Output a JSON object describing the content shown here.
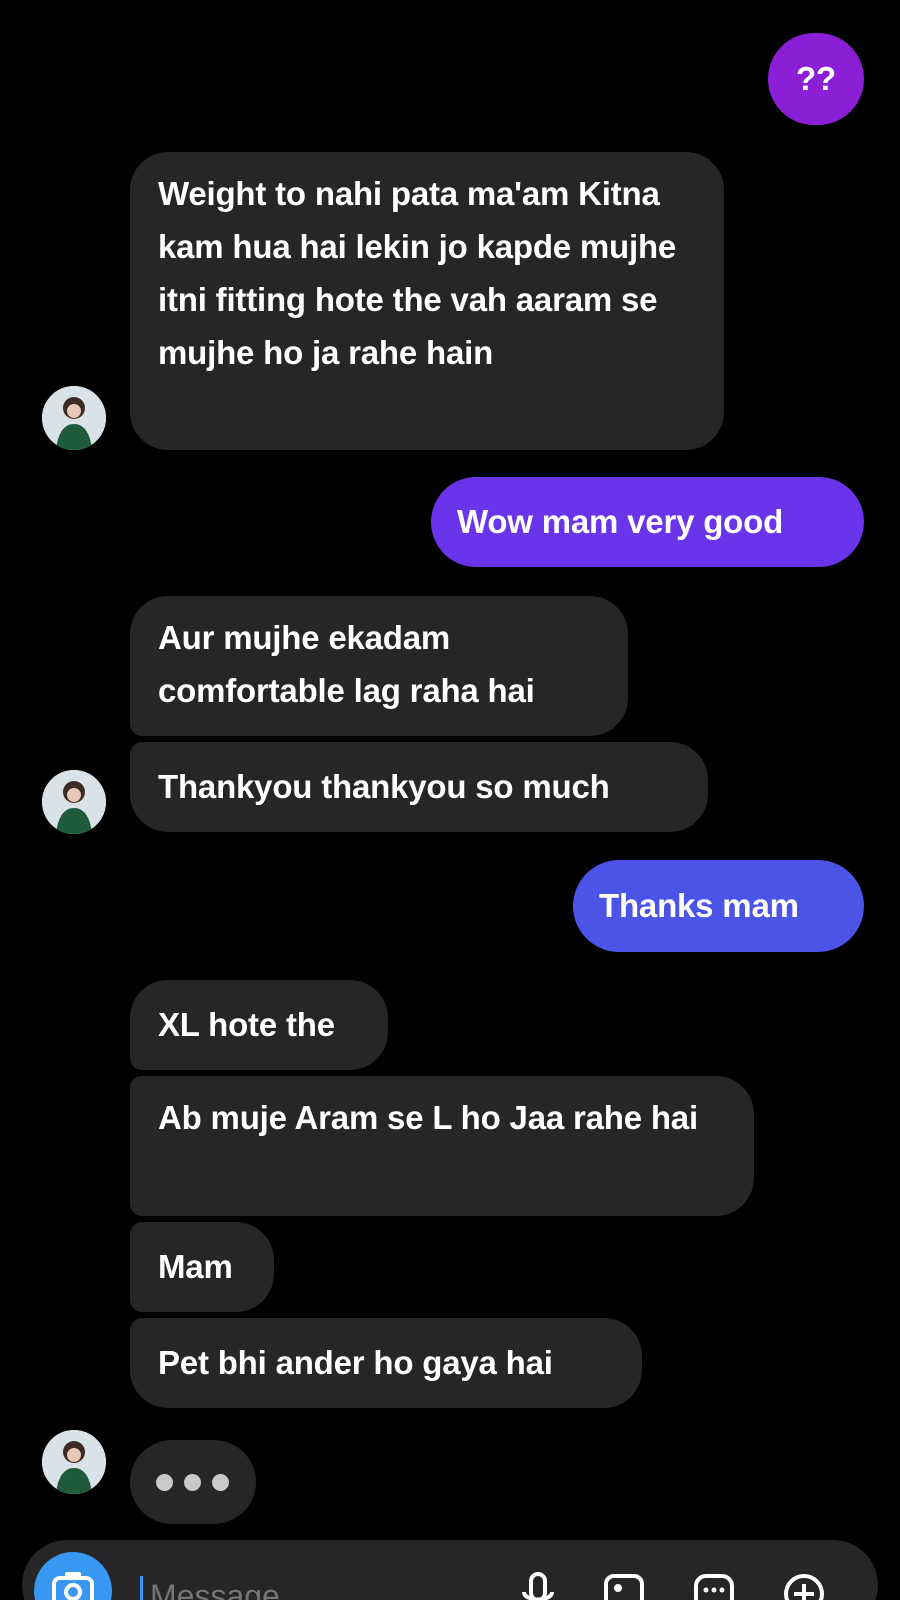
{
  "messages": [
    {
      "side": "out",
      "text": "??"
    },
    {
      "side": "in",
      "text": "Weight to nahi pata ma'am Kitna kam hua hai lekin jo kapde mujhe itni fitting hote the vah aaram se mujhe ho ja rahe hain"
    },
    {
      "side": "out",
      "text": "Wow mam very good"
    },
    {
      "side": "in",
      "text": "Aur mujhe ekadam comfortable lag raha hai"
    },
    {
      "side": "in",
      "text": "Thankyou thankyou so much"
    },
    {
      "side": "out",
      "text": "Thanks mam"
    },
    {
      "side": "in",
      "text": "XL hote the"
    },
    {
      "side": "in",
      "text": "Ab muje Aram se L ho Jaa rahe hai"
    },
    {
      "side": "in",
      "text": "Mam"
    },
    {
      "side": "in",
      "text": "Pet bhi ander ho gaya hai"
    }
  ],
  "composer": {
    "placeholder": "Message"
  },
  "icons": {
    "camera": "camera-icon",
    "mic": "microphone-icon",
    "gallery": "gallery-icon",
    "sticker": "sticker-icon",
    "add": "plus-circle-icon"
  },
  "colors": {
    "background": "#000000",
    "incoming_bubble": "#262628",
    "outgoing_purple": "#8a1fd6",
    "outgoing_violet": "#6a35ea",
    "outgoing_blue": "#4b54e6",
    "accent": "#3897f0"
  }
}
